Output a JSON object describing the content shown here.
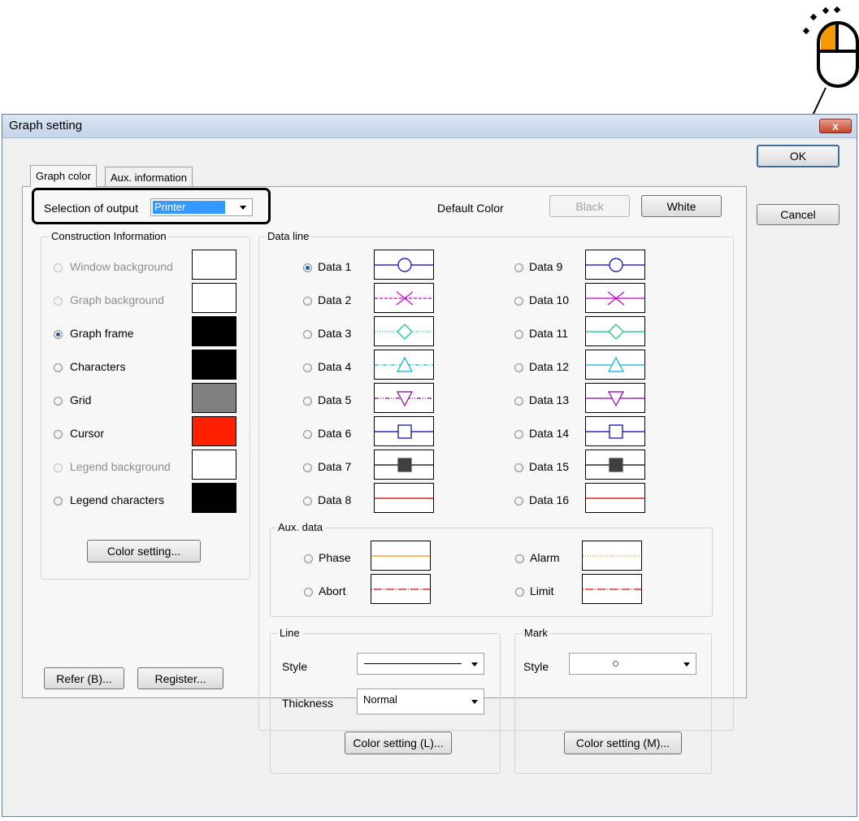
{
  "dialog": {
    "title": "Graph setting",
    "close_label": "x",
    "tabs": [
      "Graph color",
      "Aux. information"
    ],
    "ok_label": "OK",
    "cancel_label": "Cancel"
  },
  "output": {
    "label": "Selection of output",
    "selected": "Printer"
  },
  "default_color": {
    "label": "Default Color",
    "black_label": "Black",
    "white_label": "White"
  },
  "construction": {
    "title": "Construction Information",
    "items": [
      {
        "label": "Window background",
        "color": "#ffffff",
        "enabled": false,
        "checked": false
      },
      {
        "label": "Graph background",
        "color": "#ffffff",
        "enabled": false,
        "checked": false
      },
      {
        "label": "Graph frame",
        "color": "#000000",
        "enabled": true,
        "checked": true
      },
      {
        "label": "Characters",
        "color": "#000000",
        "enabled": true,
        "checked": false
      },
      {
        "label": "Grid",
        "color": "#808080",
        "enabled": true,
        "checked": false
      },
      {
        "label": "Cursor",
        "color": "#ff2000",
        "enabled": true,
        "checked": false
      },
      {
        "label": "Legend background",
        "color": "#ffffff",
        "enabled": false,
        "checked": false
      },
      {
        "label": "Legend characters",
        "color": "#000000",
        "enabled": true,
        "checked": false
      }
    ],
    "color_setting_label": "Color setting..."
  },
  "data_line": {
    "title": "Data line",
    "items": [
      {
        "label": "Data 1",
        "color": "#0000c8",
        "mark": "circle",
        "dash": "",
        "checked": true
      },
      {
        "label": "Data 2",
        "color": "#c800c8",
        "mark": "x",
        "dash": "4 2",
        "checked": false
      },
      {
        "label": "Data 3",
        "color": "#00c878",
        "mark": "diamond",
        "dash": "1 2",
        "checked": false
      },
      {
        "label": "Data 4",
        "color": "#00b4dc",
        "mark": "triangle",
        "dash": "5 2 1 2",
        "checked": false
      },
      {
        "label": "Data 5",
        "color": "#8c00a0",
        "mark": "triangle-down",
        "dash": "5 2 1 2 1 2",
        "checked": false
      },
      {
        "label": "Data 6",
        "color": "#0000a0",
        "mark": "square",
        "dash": "",
        "checked": false
      },
      {
        "label": "Data 7",
        "color": "#000000",
        "mark": "filled-square",
        "dash": "",
        "checked": false
      },
      {
        "label": "Data 8",
        "color": "#c80000",
        "mark": "none",
        "dash": "",
        "checked": false
      },
      {
        "label": "Data 9",
        "color": "#0000c8",
        "mark": "circle",
        "dash": "",
        "checked": false
      },
      {
        "label": "Data 10",
        "color": "#c800c8",
        "mark": "x",
        "dash": "",
        "checked": false
      },
      {
        "label": "Data 11",
        "color": "#00c878",
        "mark": "diamond",
        "dash": "",
        "checked": false
      },
      {
        "label": "Data 12",
        "color": "#00b4dc",
        "mark": "triangle",
        "dash": "",
        "checked": false
      },
      {
        "label": "Data 13",
        "color": "#8c00a0",
        "mark": "triangle-down",
        "dash": "",
        "checked": false
      },
      {
        "label": "Data 14",
        "color": "#0000a0",
        "mark": "square",
        "dash": "",
        "checked": false
      },
      {
        "label": "Data 15",
        "color": "#000000",
        "mark": "filled-square",
        "dash": "",
        "checked": false
      },
      {
        "label": "Data 16",
        "color": "#c80000",
        "mark": "none",
        "dash": "",
        "checked": false
      }
    ]
  },
  "aux_data": {
    "title": "Aux. data",
    "items": [
      {
        "label": "Phase",
        "color": "#ff8c00",
        "dash": ""
      },
      {
        "label": "Alarm",
        "color": "#ff8c00",
        "dash": "1 2"
      },
      {
        "label": "Abort",
        "color": "#e00000",
        "dash": "1 2 10 2"
      },
      {
        "label": "Limit",
        "color": "#e00000",
        "dash": "1 2 10 2"
      }
    ]
  },
  "line_group": {
    "title": "Line",
    "style_label": "Style",
    "thickness_label": "Thickness",
    "thickness_value": "Normal",
    "color_setting_label": "Color setting (L)..."
  },
  "mark_group": {
    "title": "Mark",
    "style_label": "Style",
    "style_value": "○",
    "color_setting_label": "Color setting (M)..."
  },
  "footer": {
    "refer_label": "Refer (B)...",
    "register_label": "Register..."
  },
  "colors": {
    "accent": "#0000ff",
    "mouse_highlight": "#f59a00"
  },
  "mouse_icon": "mouse-left-click-icon"
}
